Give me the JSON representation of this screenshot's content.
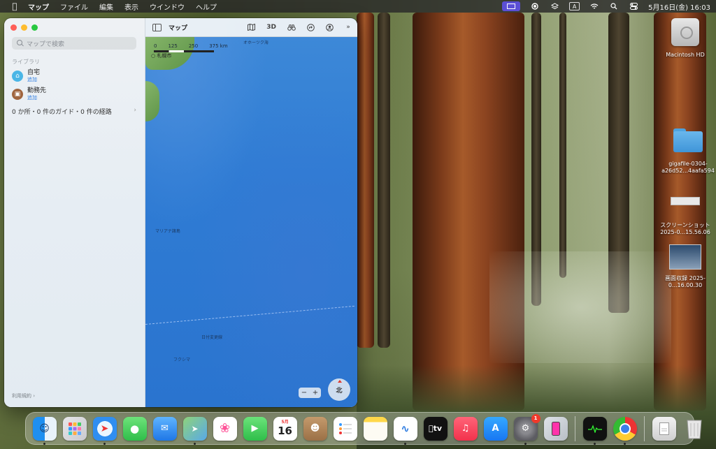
{
  "menubar": {
    "app_name": "マップ",
    "items": [
      "ファイル",
      "編集",
      "表示",
      "ウインドウ",
      "ヘルプ"
    ],
    "clock": "5月16日(金) 16:03",
    "input_mode": "A"
  },
  "maps": {
    "search_placeholder": "マップで検索",
    "section_library": "ライブラリ",
    "home_label": "自宅",
    "home_add": "追加",
    "work_label": "勤務先",
    "work_add": "追加",
    "summary": "0 か所・0 件のガイド・0 件の経路",
    "terms": "利用規約",
    "toolbar_title": "マップ",
    "toolbar_3d": "3D",
    "scale_ticks": [
      "0",
      "125",
      "250",
      "375 km"
    ],
    "place_sapporo": "札幌市",
    "compass_label": "北",
    "map_labels": [
      "マリアナ諸島",
      "日付変更線",
      "フクシマ",
      "オホーツク海"
    ]
  },
  "desktop": {
    "icons": [
      {
        "label": "Macintosh HD"
      },
      {
        "label": "gigafile-0304-a26d52...4aafa594"
      },
      {
        "label": "スクリーンショット 2025-0...15.56.06"
      },
      {
        "label": "画面収録 2025-0...16.00.30"
      }
    ]
  },
  "dock": {
    "calendar_month": "5月",
    "calendar_day": "16",
    "settings_badge": "1",
    "tv_label": "tv",
    "apps": [
      "finder",
      "launchpad",
      "safari",
      "messages",
      "mail",
      "maps",
      "photos",
      "facetime",
      "calendar",
      "contacts",
      "reminders",
      "notes",
      "freeform",
      "tv",
      "music",
      "app-store",
      "system-settings",
      "iphone-mirroring",
      "activity-monitor",
      "chrome",
      "downloads",
      "trash"
    ]
  },
  "colors": {
    "accent": "#2f7de1",
    "map_ocean": "#2f7cd4",
    "traffic_close": "#ff5f57",
    "traffic_min": "#febc2e",
    "traffic_zoom": "#28c840"
  }
}
